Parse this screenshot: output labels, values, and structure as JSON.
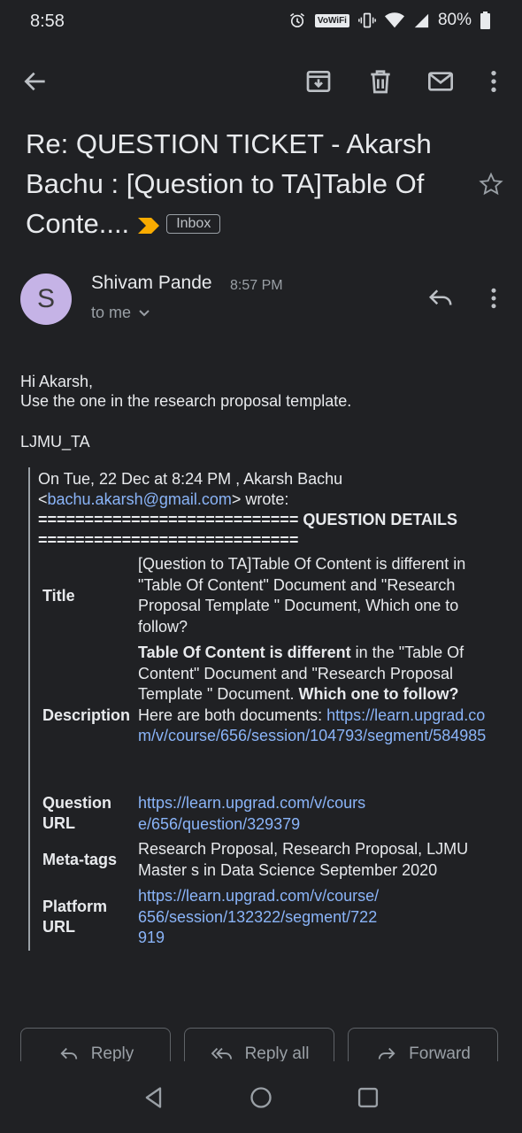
{
  "status": {
    "time": "8:58",
    "wifi_badge": "VoWiFi",
    "battery": "80%"
  },
  "toolbar": {
    "back": "arrow-back-icon",
    "archive": "archive-icon",
    "delete": "trash-icon",
    "mark_unread": "mail-icon",
    "more": "more-vert-icon"
  },
  "email": {
    "subject_line1": "Re: QUESTION TICKET - Akarsh",
    "subject_line2": "Bachu : [Question to TA]Table Of",
    "subject_line3": "Conte....",
    "label": "Inbox",
    "sender": {
      "initial": "S",
      "name": "Shivam Pande",
      "time": "8:57 PM",
      "to": "to me"
    },
    "greeting": "Hi Akarsh,",
    "message": "Use the one in the research proposal template.",
    "signature": "LJMU_TA",
    "quote": {
      "header": "On Tue, 22 Dec at 8:24 PM , Akarsh Bachu",
      "email_open": "<",
      "email": "bachu.akarsh@gmail.com",
      "email_close": "> wrote:",
      "separator1": "============================",
      "section_title": "QUESTION DETAILS",
      "separator2": "============================",
      "title_label": "Title",
      "title_value": "[Question to TA]Table Of Content is different in \"Table Of Content\" Document and \"Research Proposal Template \" Document, Which one to follow?",
      "description_label": "Description",
      "desc_bold1": "Table Of Content is different",
      "desc_text1": " in the \"Table Of Content\" Document and \"Research Proposal Template \" Document. ",
      "desc_bold2": "Which one to follow?",
      "desc_text2": " Here are both documents: ",
      "desc_link": "https://learn.upgrad.com/v/course/656/session/104793/segment/584985",
      "question_url_label": "Question URL",
      "question_url": "https://learn.upgrad.com/v/course/656/question/329379",
      "meta_label": "Meta-tags",
      "meta_value": "Research Proposal, Research Proposal, LJMU Master s in Data Science September 2020",
      "platform_label": "Platform URL",
      "platform_url": "https://learn.upgrad.com/v/course/656/session/132322/segment/722919"
    }
  },
  "actions": {
    "reply": "Reply",
    "reply_all": "Reply all",
    "forward": "Forward"
  }
}
